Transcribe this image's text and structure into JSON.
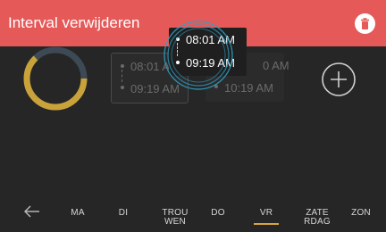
{
  "header": {
    "title": "Interval verwijderen",
    "background": "#E65959",
    "delete_icon": "trash-icon"
  },
  "schedule": {
    "slots": [
      {
        "start": "08:01 A",
        "end": "09:19 AM"
      },
      {
        "start": "0 AM",
        "end": "10:19 AM"
      }
    ],
    "add_icon": "plus-circle-icon"
  },
  "popup": {
    "start": "08:01 AM",
    "end": "09:19 AM"
  },
  "ring": {
    "colors": {
      "track": "#3d4a55",
      "fill": "#C9A23A"
    }
  },
  "days": {
    "back_icon": "arrow-left-icon",
    "items": [
      {
        "line1": "MA",
        "line2": ""
      },
      {
        "line1": "DI",
        "line2": ""
      },
      {
        "line1": "TROU",
        "line2": "WEN"
      },
      {
        "line1": "DO",
        "line2": ""
      },
      {
        "line1": "VR",
        "line2": ""
      },
      {
        "line1": "ZATE",
        "line2": "RDAG"
      },
      {
        "line1": "ZON",
        "line2": ""
      }
    ],
    "active_index": 4,
    "accent": "#D9A441"
  }
}
